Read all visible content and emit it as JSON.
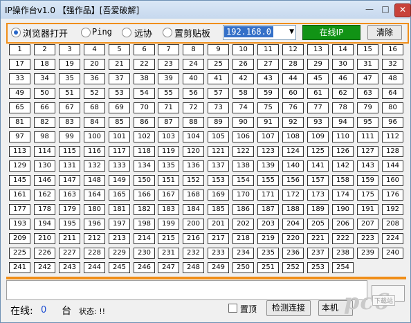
{
  "window": {
    "title": "IP操作台v1.0  【强作品】[吾爱破解]",
    "min_symbol": "—",
    "max_symbol": "□",
    "close_symbol": "✕"
  },
  "options": {
    "radios": [
      {
        "label": "浏览器打开",
        "selected": true
      },
      {
        "label": "Ping",
        "selected": false
      },
      {
        "label": "远协",
        "selected": false
      },
      {
        "label": "置剪贴板",
        "selected": false
      }
    ],
    "ip_prefix": "192.168.0",
    "dropdown_arrow": "▼",
    "online_ip_button": "在线IP",
    "clear_button": "清除"
  },
  "ip_numbers": {
    "start": 1,
    "end": 254
  },
  "status": {
    "online_label": "在线:",
    "online_count": "0",
    "unit": "台",
    "state_label": "状态: !!"
  },
  "controls": {
    "pin_label": "置顶",
    "pin_checked": false,
    "detect_button": "检测连接",
    "local_button": "本机"
  },
  "watermark": {
    "logo": "pc6",
    "text": "下载站"
  },
  "colors": {
    "accent_orange": "#f08e18",
    "online_green": "#119315",
    "selection_blue": "#3470c8"
  }
}
